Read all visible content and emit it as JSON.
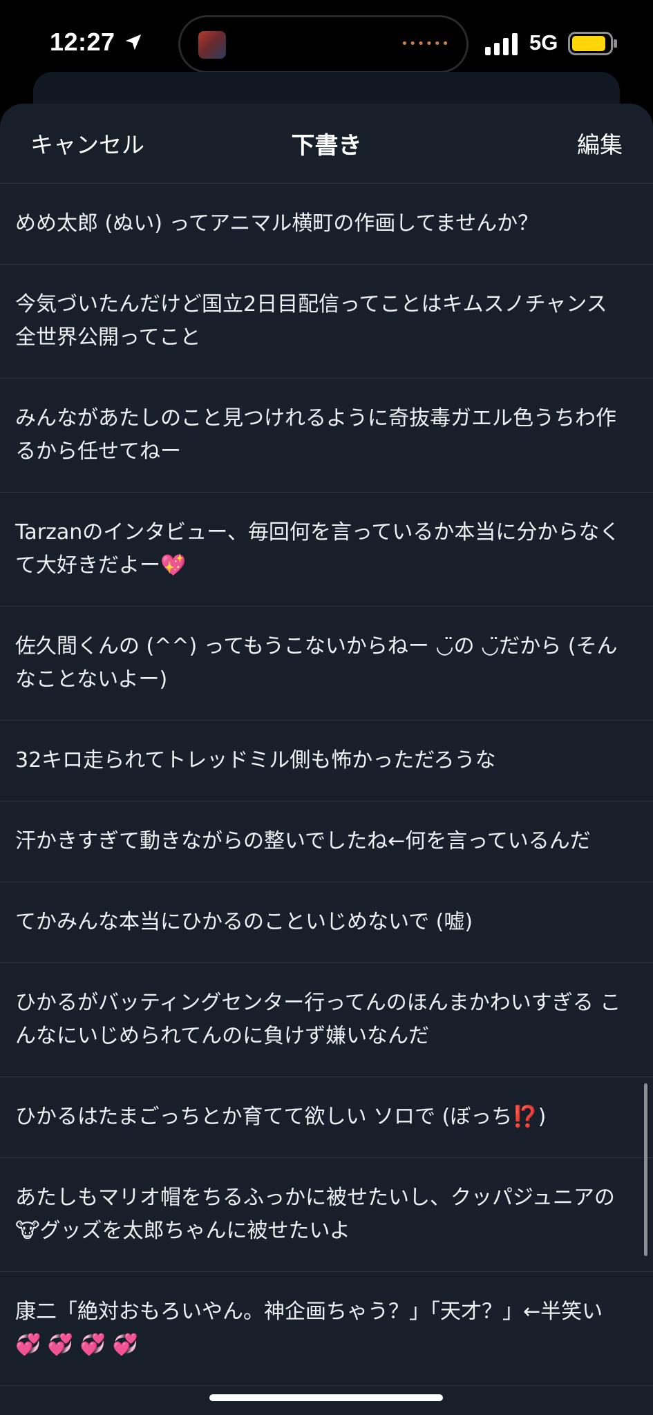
{
  "status_bar": {
    "time": "12:27",
    "network": "5G",
    "island_dots": "••••••",
    "battery_color": "#ffd60a"
  },
  "header": {
    "cancel_label": "キャンセル",
    "title": "下書き",
    "edit_label": "編集"
  },
  "drafts": [
    {
      "text": "めめ太郎 (ぬい) ってアニマル横町の作画してませんか？"
    },
    {
      "text": "今気づいたんだけど国立2日目配信ってことはキムスノチャンス全世界公開ってこと"
    },
    {
      "text": "みんながあたしのこと見つけれるように奇抜毒ガエル色うちわ作るから任せてねー"
    },
    {
      "text": "Tarzanのインタビュー、毎回何を言っているか本当に分からなくて大好きだよー💖"
    },
    {
      "text": "佐久間くんの (^^) ってもうこないからねー ◡̈の ◡̈だから (そんなことないよー)"
    },
    {
      "text": "32キロ走られてトレッドミル側も怖かっただろうな"
    },
    {
      "text": "汗かきすぎて動きながらの整いでしたね←何を言っているんだ"
    },
    {
      "text": "てかみんな本当にひかるのこといじめないで (嘘)"
    },
    {
      "text": "ひかるがバッティングセンター行ってんのほんまかわいすぎる こんなにいじめられてんのに負けず嫌いなんだ"
    },
    {
      "text": "ひかるはたまごっちとか育てて欲しい ソロで (ぼっち⁉️)"
    },
    {
      "text": "あたしもマリオ帽をちるふっかに被せたいし、クッパジュニアの🐮グッズを太郎ちゃんに被せたいよ"
    },
    {
      "text": "康二「絶対おもろいやん。神企画ちゃう？」「天才？」←半笑い💞 💞 💞 💞"
    }
  ]
}
